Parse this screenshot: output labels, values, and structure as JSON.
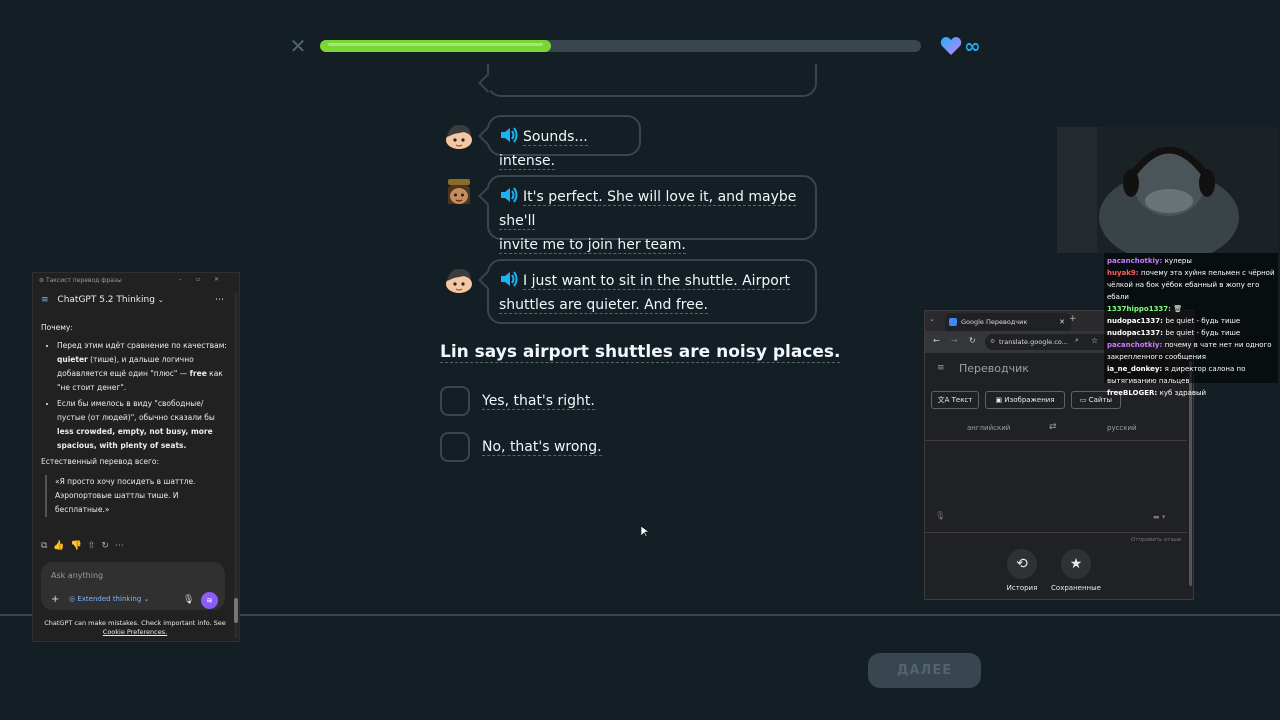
{
  "progress": {
    "fraction": 0.385,
    "color": "#79d634"
  },
  "lives": {
    "value": "∞"
  },
  "close_icon": "close-icon",
  "chat": [
    {
      "speaker": "ben",
      "text": "Sounds... intense."
    },
    {
      "speaker": "lin",
      "text_line1": "It's perfect. She will love it, and maybe she'll",
      "text_line2": "invite me to join her team."
    },
    {
      "speaker": "ben",
      "text_line1": "I just want to sit in the shuttle. Airport",
      "text_line2": "shuttles are quieter. And free."
    }
  ],
  "question": "Lin says airport shuttles are noisy places.",
  "options": [
    "Yes, that's right.",
    "No, that's wrong."
  ],
  "next_button": "ДАЛЕЕ",
  "chatgpt": {
    "window_title": "Таксист перевод фразы",
    "model": "ChatGPT 5.2 Thinking",
    "intro": "Почему:",
    "bullet1_a": "Перед этим идёт сравнение по качествам:",
    "bullet1_b": "quieter",
    "bullet1_c": " (тише), и дальше логично добавляется ещё один \"плюс\" — ",
    "bullet1_d": "free",
    "bullet1_e": " как \"не стоит денег\".",
    "bullet2_a": "Если бы имелось в виду \"свободные/пустые (от людей)\", обычно сказали бы ",
    "bullet2_b": "less crowded, empty, not busy, more spacious, with plenty of seats.",
    "natural_label": "Естественный перевод всего:",
    "quote": "«Я просто хочу посидеть в шаттле. Аэропортовые шаттлы тише. И бесплатные.»",
    "input_placeholder": "Ask anything",
    "extended": "Extended thinking",
    "footer1": "ChatGPT can make mistakes. Check important info. See",
    "footer2": "Cookie Preferences."
  },
  "translate": {
    "tab_title": "Google Переводчик",
    "url": "translate.google.co...",
    "app_title": "Переводчик",
    "mode_text": "Текст",
    "mode_images": "Изображения",
    "mode_sites": "Сайты",
    "lang_from": "английский",
    "lang_to": "русский",
    "feedback": "Отправить отзыв",
    "history": "История",
    "saved": "Сохраненные"
  },
  "stream_chat": [
    {
      "user": "pacanchotkiy",
      "color": "#c77dff",
      "msg": "кулеры"
    },
    {
      "user": "huyak9",
      "color": "#ff5c5c",
      "msg": "почему эта хуйня пельмен с чёрной чёлкой на бок уёбок ебанный в жопу его ебали"
    },
    {
      "user": "1337hippo1337",
      "color": "#7dff7d",
      "msg": "🗑"
    },
    {
      "user": "nudopac1337",
      "color": "#ffffff",
      "msg": "be quiet - будь тише"
    },
    {
      "user": "nudopac1337",
      "color": "#ffffff",
      "msg": "be quiet - будь тише"
    },
    {
      "user": "pacanchotkiy",
      "color": "#c77dff",
      "msg": "почему в чате нет ни одного закрепленного сообщения"
    },
    {
      "user": "ia_ne_donkey",
      "color": "#ffffff",
      "msg": "я директор салона по вытягиванию пальцев"
    },
    {
      "user": "freeBLOGER",
      "color": "#ffffff",
      "msg": "куб здравый"
    }
  ]
}
